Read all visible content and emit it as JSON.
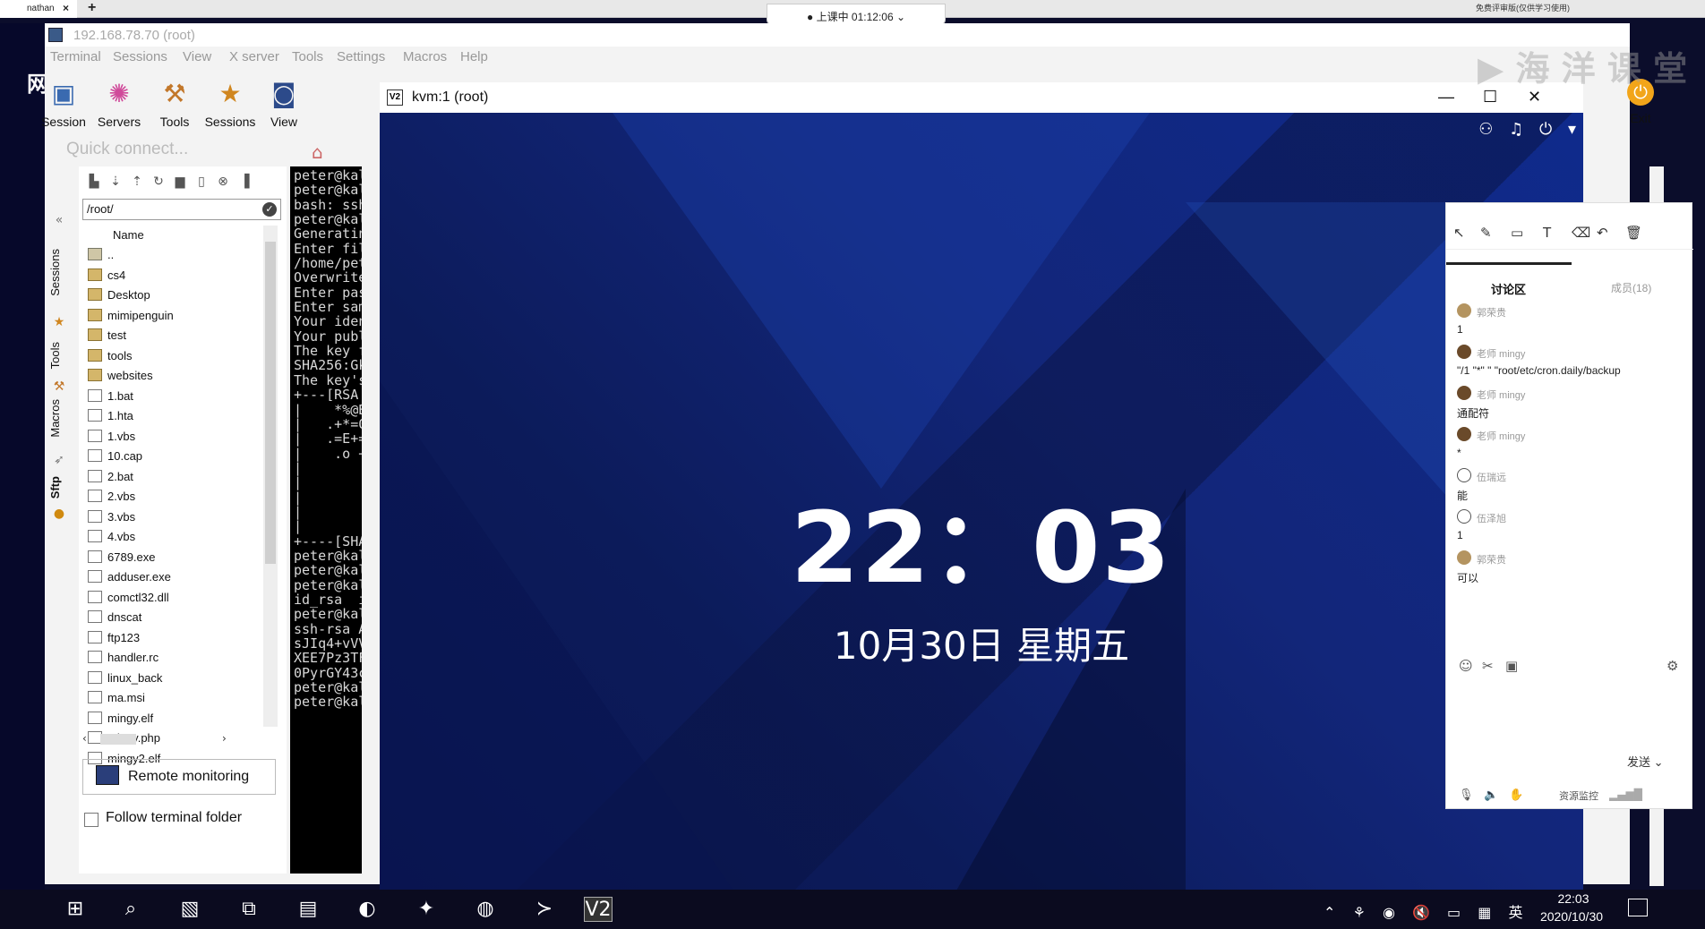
{
  "browser": {
    "tab_label": "nathan",
    "recording": "上课中 01:12:06",
    "top_right_note": "免费评审版(仅供学习使用)"
  },
  "moba": {
    "title": "192.168.78.70 (root)",
    "menu": [
      "Terminal",
      "Sessions",
      "View",
      "X server",
      "Tools",
      "Settings",
      "Macros",
      "Help"
    ],
    "toolbar": [
      {
        "label": "Session",
        "icon": "session-icon"
      },
      {
        "label": "Servers",
        "icon": "servers-icon"
      },
      {
        "label": "Tools",
        "icon": "tools-icon"
      },
      {
        "label": "Sessions",
        "icon": "sessions-star-icon"
      },
      {
        "label": "View",
        "icon": "view-icon"
      }
    ],
    "exit_label": "Exit",
    "quick_connect_placeholder": "Quick connect...",
    "side_tabs": [
      "Sessions",
      "Tools",
      "Macros",
      "Sftp"
    ],
    "sftp": {
      "path": "/root/",
      "column_name": "Name",
      "files": [
        {
          "name": "..",
          "type": "up"
        },
        {
          "name": "cs4",
          "type": "folder"
        },
        {
          "name": "Desktop",
          "type": "folder"
        },
        {
          "name": "mimipenguin",
          "type": "folder"
        },
        {
          "name": "test",
          "type": "folder"
        },
        {
          "name": "tools",
          "type": "folder"
        },
        {
          "name": "websites",
          "type": "folder"
        },
        {
          "name": "1.bat",
          "type": "file"
        },
        {
          "name": "1.hta",
          "type": "file"
        },
        {
          "name": "1.vbs",
          "type": "file"
        },
        {
          "name": "10.cap",
          "type": "file"
        },
        {
          "name": "2.bat",
          "type": "file"
        },
        {
          "name": "2.vbs",
          "type": "file"
        },
        {
          "name": "3.vbs",
          "type": "file"
        },
        {
          "name": "4.vbs",
          "type": "file"
        },
        {
          "name": "6789.exe",
          "type": "file"
        },
        {
          "name": "adduser.exe",
          "type": "file"
        },
        {
          "name": "comctl32.dll",
          "type": "file"
        },
        {
          "name": "dnscat",
          "type": "file"
        },
        {
          "name": "ftp123",
          "type": "file"
        },
        {
          "name": "handler.rc",
          "type": "file"
        },
        {
          "name": "linux_back",
          "type": "file"
        },
        {
          "name": "ma.msi",
          "type": "file"
        },
        {
          "name": "mingy.elf",
          "type": "file"
        },
        {
          "name": "mingy.php",
          "type": "file"
        },
        {
          "name": "mingy2.elf",
          "type": "file"
        }
      ],
      "remote_monitoring": "Remote monitoring",
      "follow_folder": "Follow terminal folder"
    },
    "terminal_lines": [
      "peter@kal",
      "peter@kal",
      "bash: ssh",
      "peter@kal",
      "Generatin",
      "Enter fil",
      "/home/pet",
      "Overwrite",
      "Enter pas",
      "Enter sam",
      "Your iden",
      "Your publ",
      "The key f",
      "SHA256:Gk",
      "The key's",
      "+---[RSA ",
      "|    *%@B=",
      "|   .+*=0+",
      "|   .=E+=C",
      "|    .o +=",
      "|        .",
      "|        =",
      "|        .",
      "|",
      "|",
      "+----[SHA",
      "peter@kal",
      "peter@kal",
      "peter@kal",
      "id_rsa  i",
      "peter@kal",
      "ssh-rsa A",
      "sJIq4+vVV",
      "XEE7Pz3TF",
      "0PyrGY43c",
      "peter@kal",
      "peter@kal"
    ]
  },
  "kvm": {
    "title": "kvm:1 (root)",
    "clock": "22：03",
    "date": "10月30日 星期五"
  },
  "chat": {
    "title": "讨论区",
    "members": "成员(18)",
    "messages": [
      {
        "name": "郭荣贵",
        "text": "1"
      },
      {
        "name": "老师 mingy",
        "text": "\"/1 \"*\" \" \"root/etc/cron.daily/backup"
      },
      {
        "name": "老师 mingy",
        "text": "通配符"
      },
      {
        "name": "老师 mingy",
        "text": "*"
      },
      {
        "name": "伍瑞远",
        "text": "能"
      },
      {
        "name": "伍泽旭",
        "text": "1"
      },
      {
        "name": "郭荣贵",
        "text": "可以"
      }
    ],
    "send": "发送",
    "bottom_label": "资源监控"
  },
  "taskbar": {
    "time": "22:03",
    "date": "2020/10/30",
    "ime": "英"
  },
  "colors": {
    "desktop_blue": "#10267a",
    "terminal_bg": "#000000",
    "exit_orange": "#f2a51a"
  }
}
